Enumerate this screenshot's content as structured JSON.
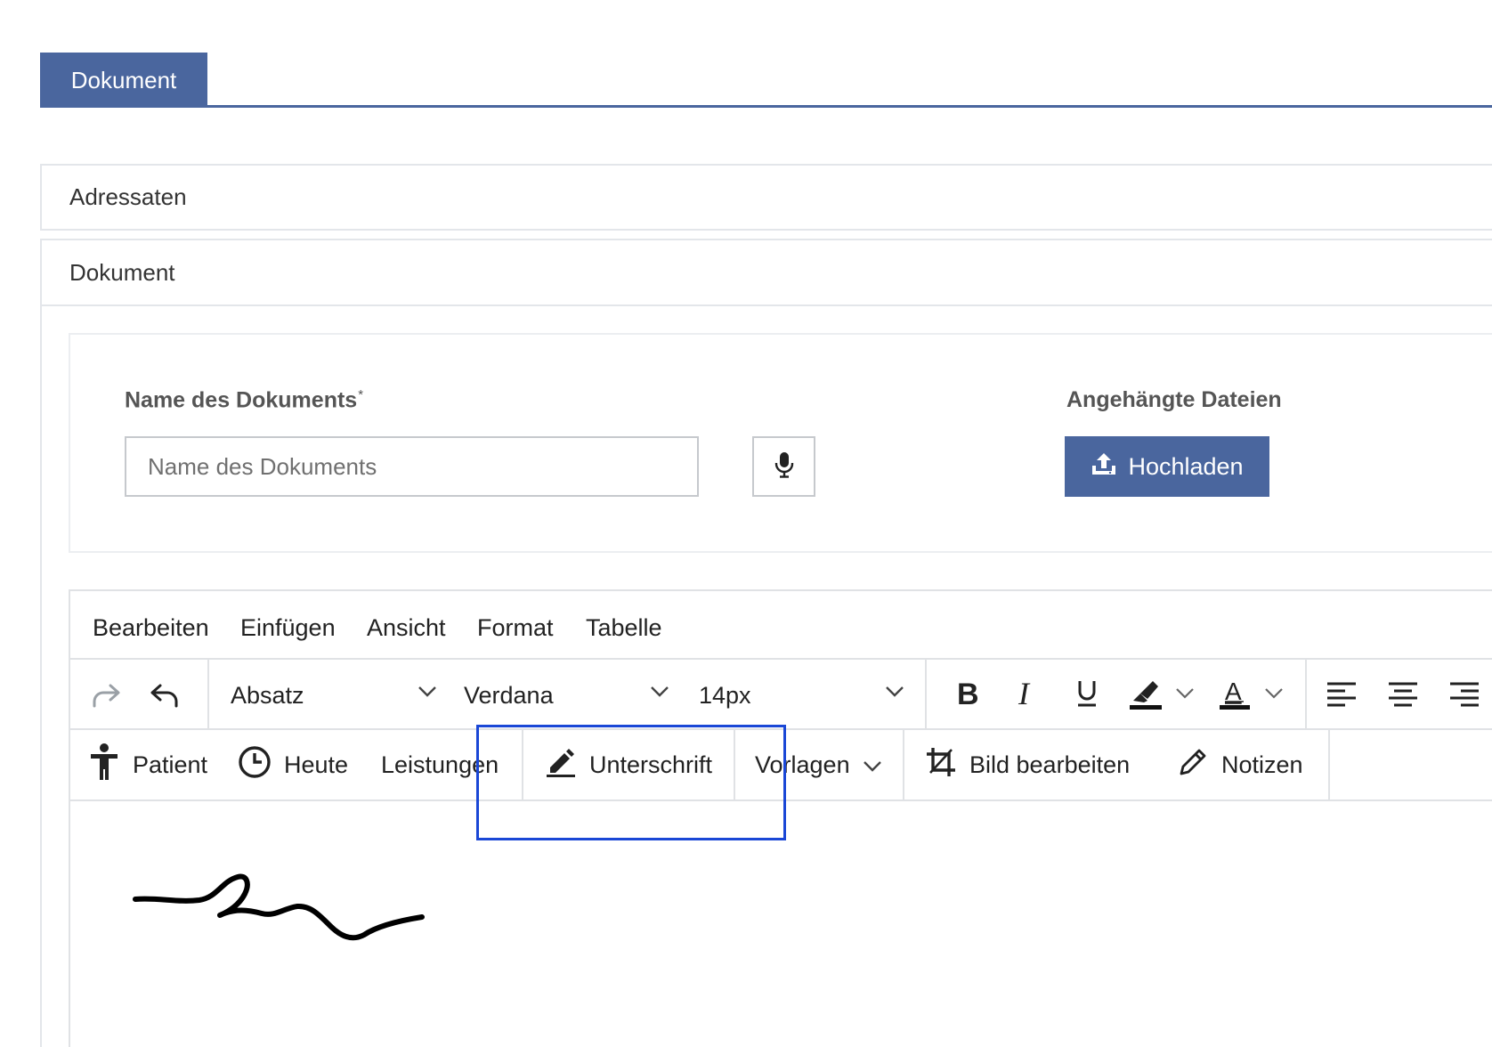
{
  "tabs": [
    {
      "label": "Dokument",
      "active": true
    }
  ],
  "accordion": {
    "sections": [
      {
        "title": "Adressaten"
      },
      {
        "title": "Dokument"
      }
    ]
  },
  "form": {
    "name_label": "Name des Dokuments",
    "required_marker": "*",
    "name_placeholder": "Name des Dokuments",
    "name_value": "",
    "files_label": "Angehängte Dateien",
    "upload_label": "Hochladen"
  },
  "editor": {
    "menu": [
      "Bearbeiten",
      "Einfügen",
      "Ansicht",
      "Format",
      "Tabelle"
    ],
    "toolbar": {
      "block_format": "Absatz",
      "font_family": "Verdana",
      "font_size": "14px"
    },
    "custom_toolbar": {
      "patient": "Patient",
      "today": "Heute",
      "services": "Leistungen",
      "signature": "Unterschrift",
      "templates": "Vorlagen",
      "edit_image": "Bild bearbeiten",
      "notes": "Notizen"
    }
  },
  "colors": {
    "accent": "#4a669e",
    "highlight_box": "#1a47d6",
    "border": "#e0e2e5"
  }
}
